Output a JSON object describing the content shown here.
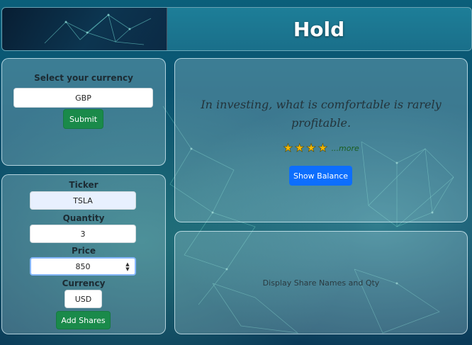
{
  "header": {
    "title": "Hold"
  },
  "currency_form": {
    "label": "Select your currency",
    "value": "GBP",
    "submit_label": "Submit"
  },
  "quote": {
    "text": "In investing, what is comfortable is rarely profitable.",
    "rating": 4,
    "more_label": "...more",
    "show_balance_label": "Show Balance"
  },
  "shares_form": {
    "ticker_label": "Ticker",
    "ticker_value": "TSLA",
    "quantity_label": "Quantity",
    "quantity_value": "3",
    "price_label": "Price",
    "price_value": "850",
    "currency_label": "Currency",
    "currency_value": "USD",
    "add_label": "Add Shares"
  },
  "display": {
    "text": "Display Share Names and Qty"
  },
  "colors": {
    "green_button": "#1a8a4a",
    "blue_button": "#0d6efd",
    "header_bg": "#1d7e98",
    "star": "#f5b800"
  },
  "icons": {
    "star": "star-icon",
    "spinner": "number-spinner-icon"
  }
}
